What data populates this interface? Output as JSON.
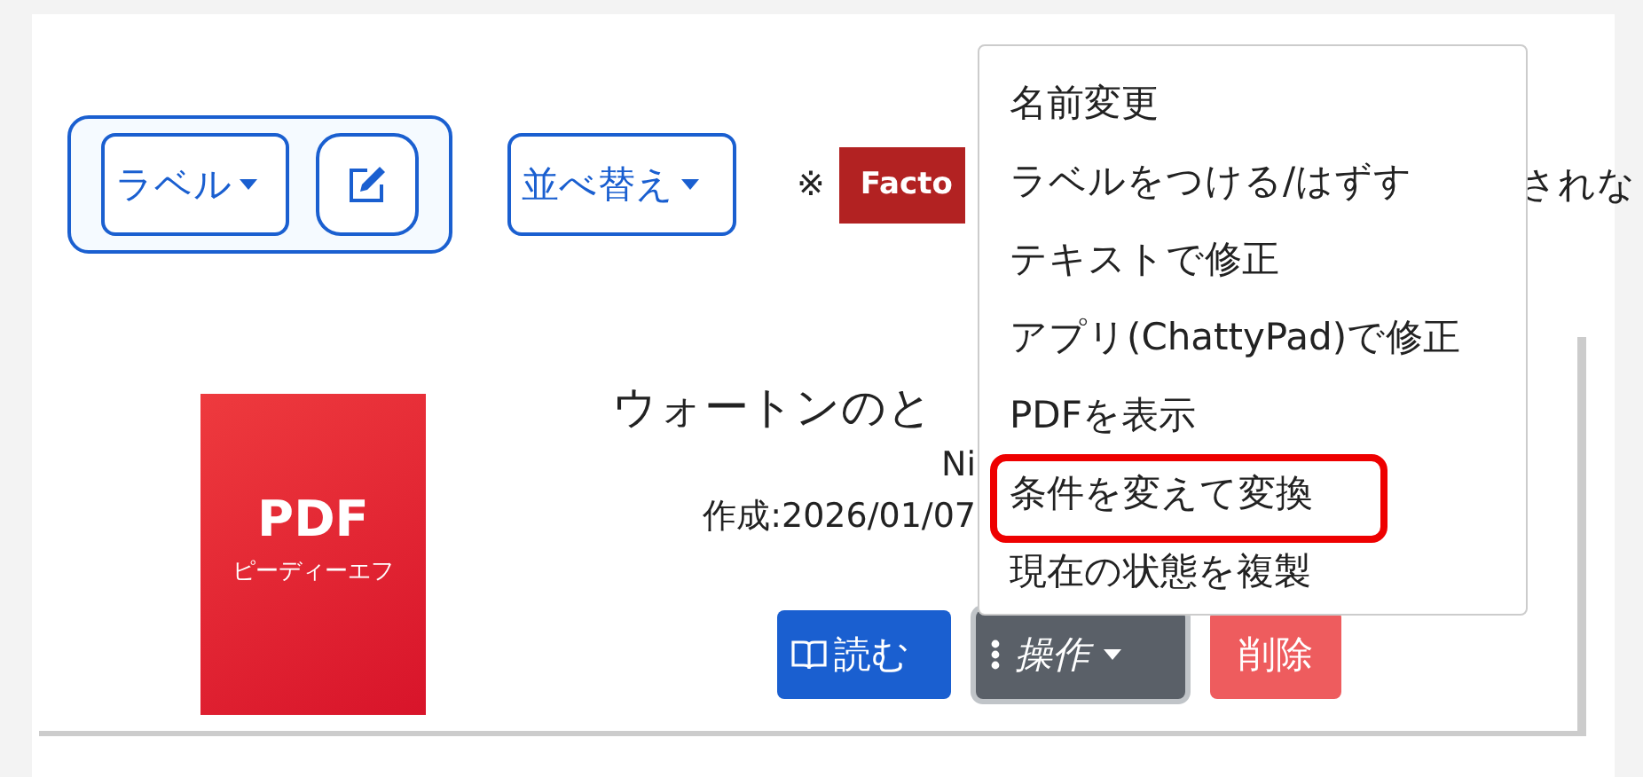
{
  "toolbar": {
    "label_button": "ラベル",
    "sort_button": "並べ替え",
    "note_mark": "※",
    "badge": "Facto",
    "note_text": "されな"
  },
  "document": {
    "thumbnail": {
      "title": "PDF",
      "subtitle": "ピーディーエフ"
    },
    "title": "ウォートンのと",
    "author": "Ni",
    "created": "作成:2026/01/07",
    "buttons": [
      {
        "kind": "read",
        "label": "読む"
      },
      {
        "kind": "actions",
        "label": "操作"
      },
      {
        "kind": "delete",
        "label": "削除"
      }
    ]
  },
  "menu": [
    {
      "label": "名前変更",
      "highlighted": false
    },
    {
      "label": "ラベルをつける/はずす",
      "highlighted": false
    },
    {
      "label": "テキストで修正",
      "highlighted": false
    },
    {
      "label": "アプリ(ChattyPad)で修正",
      "highlighted": false
    },
    {
      "label": "PDFを表示",
      "highlighted": false
    },
    {
      "label": "条件を変えて変換",
      "highlighted": true
    },
    {
      "label": "現在の状態を複製",
      "highlighted": false
    }
  ]
}
